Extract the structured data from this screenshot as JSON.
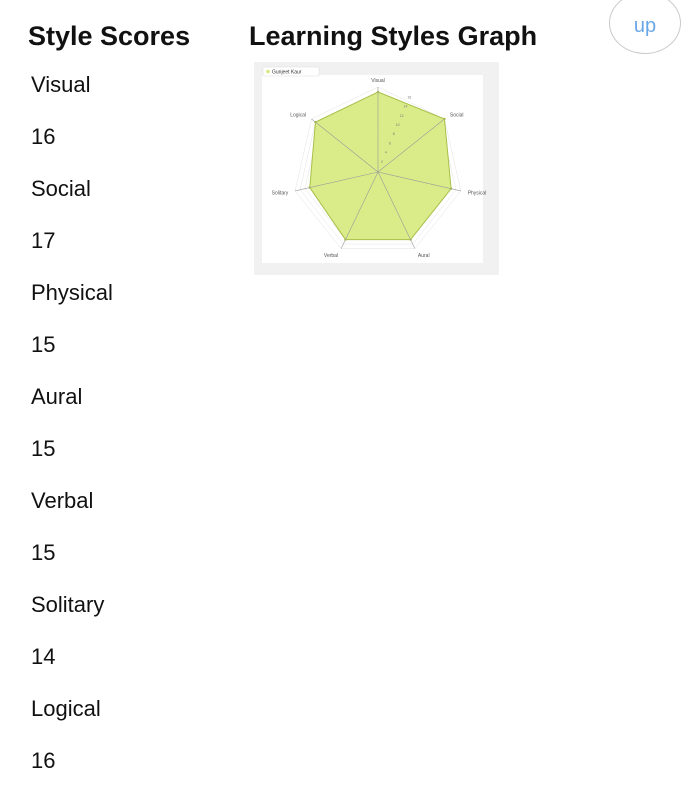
{
  "scores": {
    "heading": "Style Scores",
    "items": [
      {
        "label": "Visual",
        "value": "16"
      },
      {
        "label": "Social",
        "value": "17"
      },
      {
        "label": "Physical",
        "value": "15"
      },
      {
        "label": "Aural",
        "value": "15"
      },
      {
        "label": "Verbal",
        "value": "15"
      },
      {
        "label": "Solitary",
        "value": "14"
      },
      {
        "label": "Logical",
        "value": "16"
      }
    ]
  },
  "graph": {
    "heading": "Learning Styles Graph"
  },
  "up_button": {
    "label": "up"
  },
  "chart_data": {
    "type": "radar",
    "categories": [
      "Visual",
      "Social",
      "Physical",
      "Aural",
      "Verbal",
      "Solitary",
      "Logical"
    ],
    "series": [
      {
        "name": "Gunjeet Kaur",
        "values": [
          16,
          17,
          15,
          15,
          15,
          14,
          16
        ],
        "color": "#d6ea7c"
      }
    ],
    "rlim": [
      0,
      17
    ],
    "grid": true,
    "legend": "top-left"
  }
}
